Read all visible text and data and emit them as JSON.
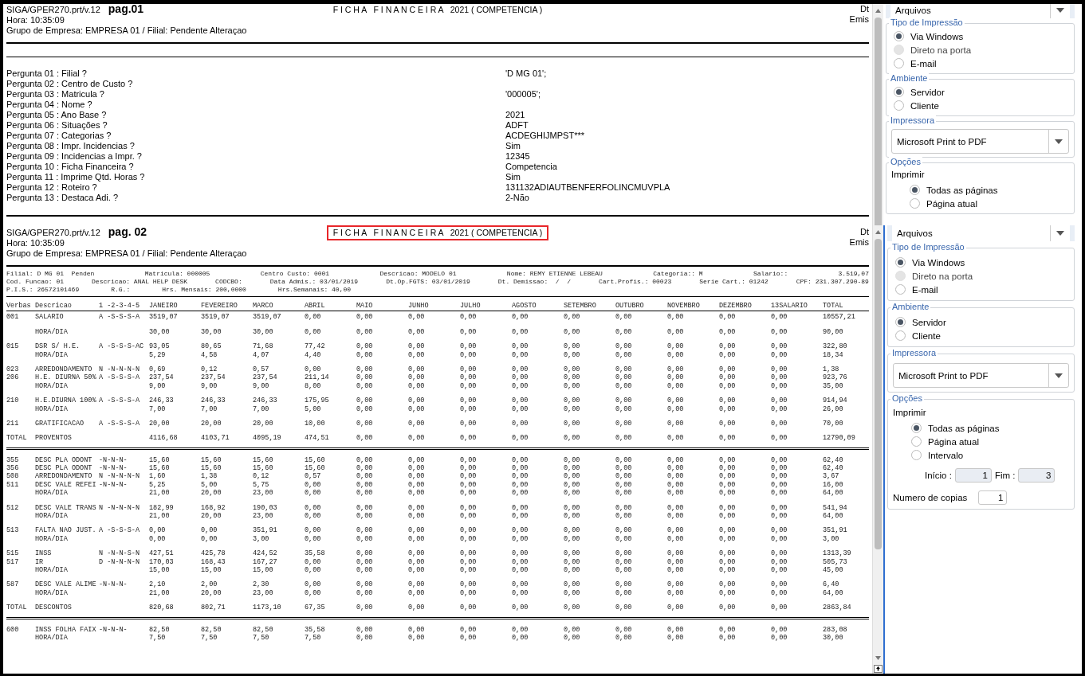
{
  "captures": [
    {
      "report": {
        "header": {
          "program": "SIGA/GPER270.prt/v.12",
          "page": "pag.01",
          "title": "F I C H A   F I N A N C E I R A   2021 ( COMPETENCIA )",
          "highlighted": false,
          "right_labels": [
            "Dt",
            "Emis"
          ],
          "time": "Hora: 10:35:09",
          "group": "Grupo de Empresa: EMPRESA 01 / Filial: Pendente Alteraçao"
        },
        "parameters": [
          {
            "label": "Pergunta 01 : Filial ?",
            "value": "'D MG 01';"
          },
          {
            "label": "Pergunta 02 : Centro de Custo ?"
          },
          {
            "label": "Pergunta 03 : Matricula ?",
            "value": "'000005';"
          },
          {
            "label": "Pergunta 04 : Nome ?"
          },
          {
            "label": "Pergunta 05 : Ano Base ?",
            "value": "2021"
          },
          {
            "label": "Pergunta 06 : Situações ?",
            "value": "ADFT"
          },
          {
            "label": "Pergunta 07 : Categorias ?",
            "value": "ACDEGHIJMPST***"
          },
          {
            "label": "Pergunta 08 : Impr. Incidencias ?",
            "value": "Sim"
          },
          {
            "label": "Pergunta 09 : Incidencias a Impr. ?",
            "value": "12345"
          },
          {
            "label": "Pergunta 10 : Ficha Financeira ?",
            "value": "Competencia"
          },
          {
            "label": "Pergunta 11 : Imprime Qtd. Horas ?",
            "value": "Sim"
          },
          {
            "label": "Pergunta 12 : Roteiro ?",
            "value": "131132ADIAUTBENFERFOLINCMUVPLA"
          },
          {
            "label": "Pergunta 13 : Destaca Adi. ?",
            "value": "2-Não"
          }
        ]
      },
      "side_panel": [
        {
          "kind": "dropdown-bar",
          "value": "Arquivos"
        },
        {
          "kind": "radio-group",
          "legend": "Tipo de Impressão",
          "options": [
            {
              "label": "Via Windows",
              "selected": true,
              "disabled": false
            },
            {
              "label": "Direto na porta",
              "selected": false,
              "disabled": true
            },
            {
              "label": "E-mail",
              "selected": false,
              "disabled": false
            }
          ]
        },
        {
          "kind": "radio-group",
          "legend": "Ambiente",
          "options": [
            {
              "label": "Servidor",
              "selected": true,
              "disabled": false
            },
            {
              "label": "Cliente",
              "selected": false,
              "disabled": false
            }
          ]
        },
        {
          "kind": "dropdown",
          "legend": "Impressora",
          "value": "Microsoft Print to PDF"
        },
        {
          "kind": "options",
          "legend": "Opções",
          "caption": "Imprimir",
          "options": [
            {
              "label": "Todas as páginas",
              "selected": true,
              "disabled": false
            },
            {
              "label": "Página atual",
              "selected": false,
              "disabled": false
            }
          ]
        }
      ]
    },
    {
      "report": {
        "header": {
          "program": "SIGA/GPER270.prt/v.12",
          "page": "pag. 02",
          "title": "F I C H A   F I N A N C E I R A   2021 ( COMPETENCIA )",
          "highlighted": true,
          "right_labels": [
            "Dt",
            "Emis"
          ],
          "time": "Hora: 10:35:09",
          "group": "Grupo de Empresa: EMPRESA 01 / Filial: Pendente Alteraçao"
        },
        "employee_info": [
          [
            "Filial: D MG 01  Penden",
            "Matricula: 000005",
            "Centro Custo: 0001",
            "Descricao: MODELO 01",
            "Nome: REMY ETIENNE LEBEAU",
            "Categoria:: M",
            "Salario::",
            "3.519,07"
          ],
          [
            "Cod. Funcao: 01",
            "Descricao: ANAL HELP DESK",
            "CODCBO:",
            "Data Admis.: 03/01/2019",
            "Dt.Op.FGTS: 03/01/2019",
            "Dt. Demissao:  /  /",
            "Cart.Profis.: 00023",
            "Serie Cart.: 01242",
            "CPF: 231.307.290-89"
          ],
          [
            "P.I.S.: 26572101469",
            "R.G.:",
            "Hrs. Mensais: 200,0000",
            "Hrs.Semanais: 40,00"
          ]
        ],
        "table": {
          "columns": [
            "Verbas",
            "Descricao",
            "1 -2-3-4-5",
            "JANEIRO",
            "FEVEREIRO",
            "MARCO",
            "ABRIL",
            "MAIO",
            "JUNHO",
            "JULHO",
            "AGOSTO",
            "SETEMBRO",
            "OUTUBRO",
            "NOVEMBRO",
            "DEZEMBRO",
            "13SALARIO",
            "TOTAL"
          ],
          "blocks": [
            {
              "kind": "rows",
              "rows": [
                {
                  "code": "001",
                  "description": "SALARIO",
                  "flags": "A -S-S-S-A",
                  "values": [
                    "3519,07",
                    "3519,07",
                    "3519,07",
                    "0,00",
                    "0,00",
                    "0,00",
                    "0,00",
                    "0,00",
                    "0,00",
                    "0,00",
                    "0,00",
                    "0,00",
                    "0,00",
                    "10557,21"
                  ]
                }
              ]
            },
            {
              "kind": "rows",
              "rows": [
                {
                  "description": "HORA/DIA",
                  "values": [
                    "30,00",
                    "30,00",
                    "30,00",
                    "0,00",
                    "0,00",
                    "0,00",
                    "0,00",
                    "0,00",
                    "0,00",
                    "0,00",
                    "0,00",
                    "0,00",
                    "0,00",
                    "90,00"
                  ]
                }
              ]
            },
            {
              "kind": "rows",
              "rows": [
                {
                  "code": "015",
                  "description": "DSR S/ H.E.",
                  "flags": "A -S-S-S-AC",
                  "values": [
                    "93,05",
                    "80,65",
                    "71,68",
                    "77,42",
                    "0,00",
                    "0,00",
                    "0,00",
                    "0,00",
                    "0,00",
                    "0,00",
                    "0,00",
                    "0,00",
                    "0,00",
                    "322,80"
                  ]
                },
                {
                  "description": "HORA/DIA",
                  "values": [
                    "5,29",
                    "4,58",
                    "4,07",
                    "4,40",
                    "0,00",
                    "0,00",
                    "0,00",
                    "0,00",
                    "0,00",
                    "0,00",
                    "0,00",
                    "0,00",
                    "0,00",
                    "18,34"
                  ]
                }
              ]
            },
            {
              "kind": "rows",
              "rows": [
                {
                  "code": "023",
                  "description": "ARREDONDAMENTO",
                  "flags": "N -N-N-N-N",
                  "values": [
                    "0,69",
                    "0,12",
                    "0,57",
                    "0,00",
                    "0,00",
                    "0,00",
                    "0,00",
                    "0,00",
                    "0,00",
                    "0,00",
                    "0,00",
                    "0,00",
                    "0,00",
                    "1,38"
                  ]
                },
                {
                  "code": "206",
                  "description": "H.E. DIURNA 50%",
                  "flags": "A -S-S-S-A",
                  "values": [
                    "237,54",
                    "237,54",
                    "237,54",
                    "211,14",
                    "0,00",
                    "0,00",
                    "0,00",
                    "0,00",
                    "0,00",
                    "0,00",
                    "0,00",
                    "0,00",
                    "0,00",
                    "923,76"
                  ]
                },
                {
                  "description": "HORA/DIA",
                  "values": [
                    "9,00",
                    "9,00",
                    "9,00",
                    "8,00",
                    "0,00",
                    "0,00",
                    "0,00",
                    "0,00",
                    "0,00",
                    "0,00",
                    "0,00",
                    "0,00",
                    "0,00",
                    "35,00"
                  ]
                }
              ]
            },
            {
              "kind": "rows",
              "rows": [
                {
                  "code": "210",
                  "description": "H.E.DIURNA 100%",
                  "flags": "A -S-S-S-A",
                  "values": [
                    "246,33",
                    "246,33",
                    "246,33",
                    "175,95",
                    "0,00",
                    "0,00",
                    "0,00",
                    "0,00",
                    "0,00",
                    "0,00",
                    "0,00",
                    "0,00",
                    "0,00",
                    "914,94"
                  ]
                },
                {
                  "description": "HORA/DIA",
                  "values": [
                    "7,00",
                    "7,00",
                    "7,00",
                    "5,00",
                    "0,00",
                    "0,00",
                    "0,00",
                    "0,00",
                    "0,00",
                    "0,00",
                    "0,00",
                    "0,00",
                    "0,00",
                    "26,00"
                  ]
                }
              ]
            },
            {
              "kind": "rows",
              "rows": [
                {
                  "code": "211",
                  "description": "GRATIFICACAO",
                  "flags": "A -S-S-S-A",
                  "values": [
                    "20,00",
                    "20,00",
                    "20,00",
                    "10,00",
                    "0,00",
                    "0,00",
                    "0,00",
                    "0,00",
                    "0,00",
                    "0,00",
                    "0,00",
                    "0,00",
                    "0,00",
                    "70,00"
                  ]
                }
              ]
            },
            {
              "kind": "rows",
              "rows": [
                {
                  "code": "TOTAL",
                  "description": "PROVENTOS",
                  "values": [
                    "4116,68",
                    "4103,71",
                    "4095,19",
                    "474,51",
                    "0,00",
                    "0,00",
                    "0,00",
                    "0,00",
                    "0,00",
                    "0,00",
                    "0,00",
                    "0,00",
                    "0,00",
                    "12790,09"
                  ]
                }
              ]
            },
            {
              "kind": "double-rule"
            },
            {
              "kind": "rows",
              "rows": [
                {
                  "code": "355",
                  "description": "DESC PLA ODONT",
                  "flags": "-N-N-N-",
                  "values": [
                    "15,60",
                    "15,60",
                    "15,60",
                    "15,60",
                    "0,00",
                    "0,00",
                    "0,00",
                    "0,00",
                    "0,00",
                    "0,00",
                    "0,00",
                    "0,00",
                    "0,00",
                    "62,40"
                  ]
                },
                {
                  "code": "356",
                  "description": "DESC PLA ODONT",
                  "flags": "-N-N-N-",
                  "values": [
                    "15,60",
                    "15,60",
                    "15,60",
                    "15,60",
                    "0,00",
                    "0,00",
                    "0,00",
                    "0,00",
                    "0,00",
                    "0,00",
                    "0,00",
                    "0,00",
                    "0,00",
                    "62,40"
                  ]
                },
                {
                  "code": "508",
                  "description": "ARREDONDAMENTO",
                  "flags": "N -N-N-N-N",
                  "values": [
                    "1,60",
                    "1,38",
                    "0,12",
                    "0,57",
                    "0,00",
                    "0,00",
                    "0,00",
                    "0,00",
                    "0,00",
                    "0,00",
                    "0,00",
                    "0,00",
                    "0,00",
                    "3,67"
                  ]
                },
                {
                  "code": "511",
                  "description": "DESC VALE REFEI",
                  "flags": "-N-N-N-",
                  "values": [
                    "5,25",
                    "5,00",
                    "5,75",
                    "0,00",
                    "0,00",
                    "0,00",
                    "0,00",
                    "0,00",
                    "0,00",
                    "0,00",
                    "0,00",
                    "0,00",
                    "0,00",
                    "16,00"
                  ]
                },
                {
                  "description": "HORA/DIA",
                  "values": [
                    "21,00",
                    "20,00",
                    "23,00",
                    "0,00",
                    "0,00",
                    "0,00",
                    "0,00",
                    "0,00",
                    "0,00",
                    "0,00",
                    "0,00",
                    "0,00",
                    "0,00",
                    "64,00"
                  ]
                }
              ]
            },
            {
              "kind": "rows",
              "rows": [
                {
                  "code": "512",
                  "description": "DESC VALE TRANS",
                  "flags": "N -N-N-N-N",
                  "values": [
                    "182,99",
                    "168,92",
                    "190,03",
                    "0,00",
                    "0,00",
                    "0,00",
                    "0,00",
                    "0,00",
                    "0,00",
                    "0,00",
                    "0,00",
                    "0,00",
                    "0,00",
                    "541,94"
                  ]
                },
                {
                  "description": "HORA/DIA",
                  "values": [
                    "21,00",
                    "20,00",
                    "23,00",
                    "0,00",
                    "0,00",
                    "0,00",
                    "0,00",
                    "0,00",
                    "0,00",
                    "0,00",
                    "0,00",
                    "0,00",
                    "0,00",
                    "64,00"
                  ]
                }
              ]
            },
            {
              "kind": "rows",
              "rows": [
                {
                  "code": "513",
                  "description": "FALTA NAO JUST.",
                  "flags": "A -S-S-S-A",
                  "values": [
                    "0,00",
                    "0,00",
                    "351,91",
                    "0,00",
                    "0,00",
                    "0,00",
                    "0,00",
                    "0,00",
                    "0,00",
                    "0,00",
                    "0,00",
                    "0,00",
                    "0,00",
                    "351,91"
                  ]
                },
                {
                  "description": "HORA/DIA",
                  "values": [
                    "0,00",
                    "0,00",
                    "3,00",
                    "0,00",
                    "0,00",
                    "0,00",
                    "0,00",
                    "0,00",
                    "0,00",
                    "0,00",
                    "0,00",
                    "0,00",
                    "0,00",
                    "3,00"
                  ]
                }
              ]
            },
            {
              "kind": "rows",
              "rows": [
                {
                  "code": "515",
                  "description": "INSS",
                  "flags": "N -N-N-S-N",
                  "values": [
                    "427,51",
                    "425,78",
                    "424,52",
                    "35,58",
                    "0,00",
                    "0,00",
                    "0,00",
                    "0,00",
                    "0,00",
                    "0,00",
                    "0,00",
                    "0,00",
                    "0,00",
                    "1313,39"
                  ]
                },
                {
                  "code": "517",
                  "description": "IR",
                  "flags": "D -N-N-N-N",
                  "values": [
                    "170,03",
                    "168,43",
                    "167,27",
                    "0,00",
                    "0,00",
                    "0,00",
                    "0,00",
                    "0,00",
                    "0,00",
                    "0,00",
                    "0,00",
                    "0,00",
                    "0,00",
                    "505,73"
                  ]
                },
                {
                  "description": "HORA/DIA",
                  "values": [
                    "15,00",
                    "15,00",
                    "15,00",
                    "0,00",
                    "0,00",
                    "0,00",
                    "0,00",
                    "0,00",
                    "0,00",
                    "0,00",
                    "0,00",
                    "0,00",
                    "0,00",
                    "45,00"
                  ]
                }
              ]
            },
            {
              "kind": "rows",
              "rows": [
                {
                  "code": "587",
                  "description": "DESC VALE ALIME",
                  "flags": "-N-N-N-",
                  "values": [
                    "2,10",
                    "2,00",
                    "2,30",
                    "0,00",
                    "0,00",
                    "0,00",
                    "0,00",
                    "0,00",
                    "0,00",
                    "0,00",
                    "0,00",
                    "0,00",
                    "0,00",
                    "6,40"
                  ]
                },
                {
                  "description": "HORA/DIA",
                  "values": [
                    "21,00",
                    "20,00",
                    "23,00",
                    "0,00",
                    "0,00",
                    "0,00",
                    "0,00",
                    "0,00",
                    "0,00",
                    "0,00",
                    "0,00",
                    "0,00",
                    "0,00",
                    "64,00"
                  ]
                }
              ]
            },
            {
              "kind": "rows",
              "rows": [
                {
                  "code": "TOTAL",
                  "description": "DESCONTOS",
                  "values": [
                    "820,68",
                    "802,71",
                    "1173,10",
                    "67,35",
                    "0,00",
                    "0,00",
                    "0,00",
                    "0,00",
                    "0,00",
                    "0,00",
                    "0,00",
                    "0,00",
                    "0,00",
                    "2863,84"
                  ]
                }
              ]
            },
            {
              "kind": "double-rule"
            },
            {
              "kind": "rows",
              "rows": [
                {
                  "code": "600",
                  "description": "INSS FOLHA FAIX",
                  "flags": "-N-N-N-",
                  "values": [
                    "82,50",
                    "82,50",
                    "82,50",
                    "35,58",
                    "0,00",
                    "0,00",
                    "0,00",
                    "0,00",
                    "0,00",
                    "0,00",
                    "0,00",
                    "0,00",
                    "0,00",
                    "283,08"
                  ]
                },
                {
                  "description": "HORA/DIA",
                  "values": [
                    "7,50",
                    "7,50",
                    "7,50",
                    "7,50",
                    "0,00",
                    "0,00",
                    "0,00",
                    "0,00",
                    "0,00",
                    "0,00",
                    "0,00",
                    "0,00",
                    "0,00",
                    "30,00"
                  ]
                }
              ]
            }
          ]
        }
      },
      "side_panel": [
        {
          "kind": "dropdown-bar",
          "value": "Arquivos"
        },
        {
          "kind": "radio-group",
          "legend": "Tipo de Impressão",
          "options": [
            {
              "label": "Via Windows",
              "selected": true,
              "disabled": false
            },
            {
              "label": "Direto na porta",
              "selected": false,
              "disabled": true
            },
            {
              "label": "E-mail",
              "selected": false,
              "disabled": false
            }
          ]
        },
        {
          "kind": "radio-group",
          "legend": "Ambiente",
          "options": [
            {
              "label": "Servidor",
              "selected": true,
              "disabled": false
            },
            {
              "label": "Cliente",
              "selected": false,
              "disabled": false
            }
          ]
        },
        {
          "kind": "dropdown",
          "legend": "Impressora",
          "value": "Microsoft Print to PDF"
        },
        {
          "kind": "options",
          "legend": "Opções",
          "caption": "Imprimir",
          "options": [
            {
              "label": "Todas as páginas",
              "selected": true,
              "disabled": false
            },
            {
              "label": "Página atual",
              "selected": false,
              "disabled": false
            },
            {
              "label": "Intervalo",
              "selected": false,
              "disabled": false
            }
          ],
          "range": {
            "start_label": "Início :",
            "start": "1",
            "end_label": "Fim :",
            "end": "3"
          },
          "copies": {
            "label": "Numero de copias",
            "value": "1"
          }
        }
      ]
    }
  ]
}
